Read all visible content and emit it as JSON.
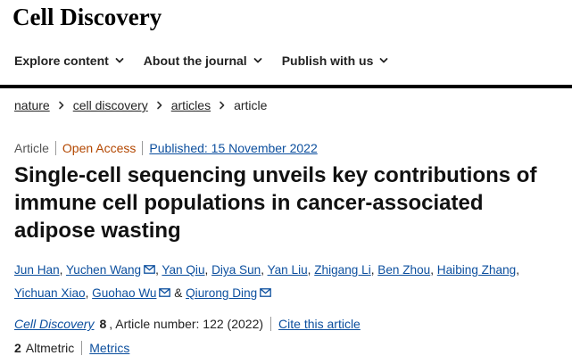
{
  "header": {
    "journal_name": "Cell Discovery"
  },
  "nav": {
    "items": [
      {
        "label": "Explore content",
        "icon": "chevron-down-icon"
      },
      {
        "label": "About the journal",
        "icon": "chevron-down-icon"
      },
      {
        "label": "Publish with us",
        "icon": "chevron-down-icon"
      }
    ]
  },
  "breadcrumb": {
    "items": [
      "nature",
      "cell discovery",
      "articles"
    ],
    "current": "article",
    "separator_icon": "chevron-right-icon"
  },
  "article": {
    "type": "Article",
    "access": "Open Access",
    "published": "Published: 15 November 2022",
    "title": "Single-cell sequencing unveils key contributions of immune cell populations in cancer-associated adipose wasting",
    "authors": [
      {
        "name": "Jun Han",
        "email": false
      },
      {
        "name": "Yuchen Wang",
        "email": true
      },
      {
        "name": "Yan Qiu",
        "email": false
      },
      {
        "name": "Diya Sun",
        "email": false
      },
      {
        "name": "Yan Liu",
        "email": false
      },
      {
        "name": "Zhigang Li",
        "email": false
      },
      {
        "name": "Ben Zhou",
        "email": false
      },
      {
        "name": "Haibing Zhang",
        "email": false
      },
      {
        "name": "Yichuan Xiao",
        "email": false
      },
      {
        "name": "Guohao Wu",
        "email": true
      },
      {
        "name": "Qiurong Ding",
        "email": true
      }
    ],
    "author_separator": ", ",
    "last_author_joiner": " & "
  },
  "citation": {
    "journal": "Cell Discovery",
    "volume": "8",
    "article_number": ", Article number: 122 (2022)",
    "cite_label": "Cite this article"
  },
  "metrics": {
    "altmetric_count": "2",
    "altmetric_label": "Altmetric",
    "metrics_label": "Metrics"
  },
  "colors": {
    "link": "#0c4f9e",
    "open_access": "#b34700",
    "rule": "#000000",
    "text": "#222222"
  }
}
